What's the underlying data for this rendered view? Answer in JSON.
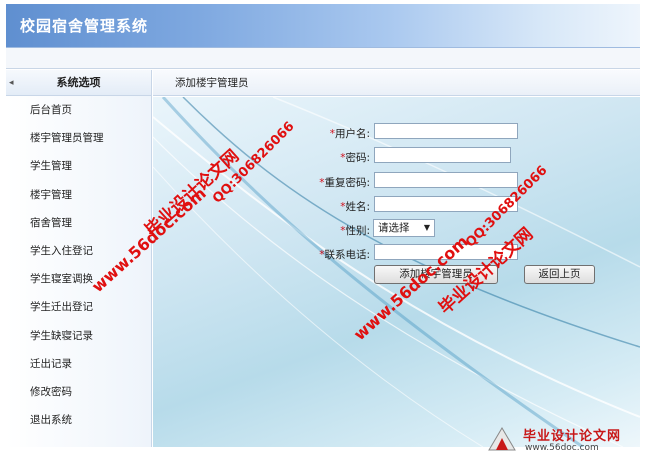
{
  "app": {
    "title": "校园宿舍管理系统"
  },
  "sidebar": {
    "heading": "系统选项",
    "items": [
      {
        "label": "后台首页"
      },
      {
        "label": "楼宇管理员管理"
      },
      {
        "label": "学生管理"
      },
      {
        "label": "楼宇管理"
      },
      {
        "label": "宿舍管理"
      },
      {
        "label": "学生入住登记"
      },
      {
        "label": "学生寝室调换"
      },
      {
        "label": "学生迁出登记"
      },
      {
        "label": "学生缺寝记录"
      },
      {
        "label": "迁出记录"
      },
      {
        "label": "修改密码"
      },
      {
        "label": "退出系统"
      }
    ]
  },
  "page": {
    "breadcrumb": "添加楼宇管理员"
  },
  "form": {
    "required_mark": "*",
    "username_label": "用户名:",
    "password_label": "密码:",
    "confirm_label": "重复密码:",
    "name_label": "姓名:",
    "gender_label": "性别:",
    "gender_value": "请选择",
    "phone_label": "联系电话:",
    "submit_label": "添加楼宇管理员",
    "back_label": "返回上页"
  },
  "watermarks": {
    "site": "www.56doc.com",
    "qq": "QQ:306826066",
    "brand": "毕业设计论文网",
    "footer_brand": "毕业设计论文网",
    "footer_site": "www.56doc.com"
  }
}
